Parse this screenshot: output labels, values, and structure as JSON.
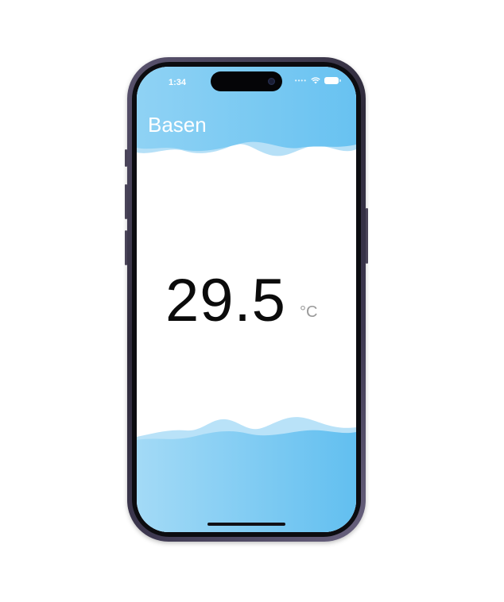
{
  "status_bar": {
    "time": "1:34",
    "signal_icon": "dots-icon",
    "wifi_icon": "wifi-icon",
    "battery_icon": "battery-icon"
  },
  "header": {
    "title": "Basen"
  },
  "reading": {
    "value": "29.5",
    "unit": "°C"
  },
  "colors": {
    "wave_light": "#a9dcf6",
    "wave_main": "#7fcbf2",
    "wave_deep": "#5fbdf0",
    "text_primary": "#0b0b0b",
    "unit_text": "#9a9a9a"
  }
}
